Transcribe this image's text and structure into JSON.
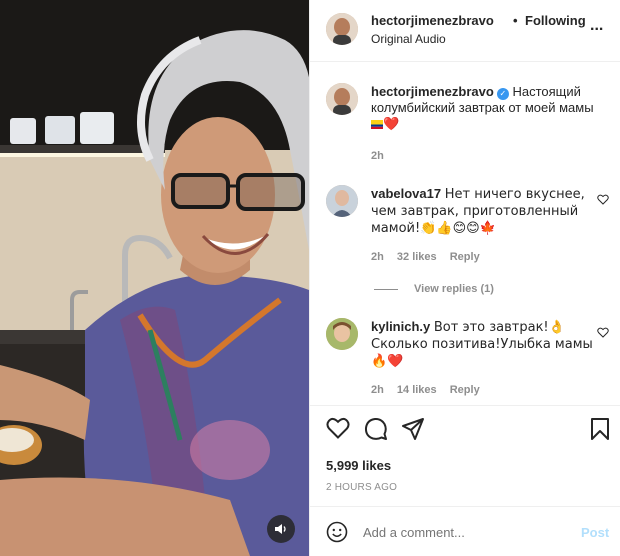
{
  "header": {
    "username": "hectorjimenezbravo",
    "separator": "•",
    "follow_state": "Following",
    "audio": "Original Audio",
    "more": "..."
  },
  "caption": {
    "username": "hectorjimenezbravo",
    "verified_mark": "✓",
    "text": "Настоящий колумбийский завтрак от моей мамы",
    "trailing_emoji": "❤️",
    "time": "2h"
  },
  "comments": [
    {
      "username": "vabelova17",
      "text": "Нет ничего вкуснее, чем завтрак, приготовленный мамой!👏👍😊😊🍁",
      "time": "2h",
      "likes": "32 likes",
      "reply": "Reply"
    },
    {
      "username": "kylinich.y",
      "text": "Вот это завтрак!👌 Сколько позитива!Улыбка мамы 🔥❤️",
      "time": "2h",
      "likes": "14 likes",
      "reply": "Reply"
    }
  ],
  "view_replies": "View replies (1)",
  "post": {
    "likes": "5,999 likes",
    "time_ago": "2 HOURS AGO"
  },
  "add_comment": {
    "placeholder": "Add a comment...",
    "post_label": "Post"
  },
  "colors": {
    "link_blue": "#3897f0",
    "post_disabled": "#b2dffc",
    "muted": "#8e8e8e"
  }
}
